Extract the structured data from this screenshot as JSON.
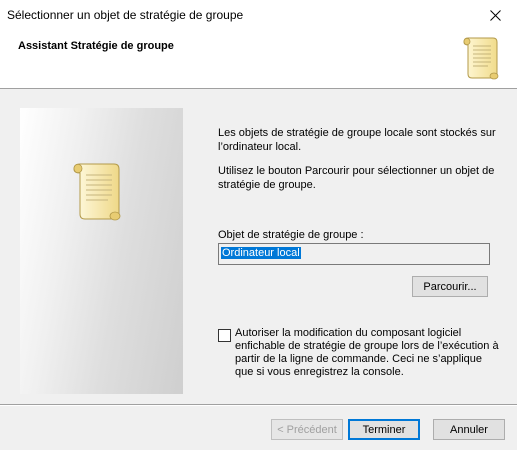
{
  "window": {
    "title": "Sélectionner un objet de stratégie de groupe"
  },
  "header": {
    "title": "Assistant Stratégie de groupe",
    "icon": "scroll-icon"
  },
  "side_panel": {
    "icon": "scroll-icon"
  },
  "description": {
    "line1": "Les objets de stratégie de groupe locale sont stockés sur l’ordinateur local.",
    "line2": "Utilisez le bouton Parcourir pour sélectionner un objet de stratégie de groupe."
  },
  "gpo_field": {
    "label": "Objet de stratégie de groupe :",
    "value": "Ordinateur local"
  },
  "buttons": {
    "browse": "Parcourir...",
    "previous": "< Précédent",
    "finish": "Terminer",
    "cancel": "Annuler"
  },
  "option": {
    "checked": false,
    "label": "Autoriser la modification du composant logiciel enfichable de stratégie de groupe lors de l’exécution à partir de la ligne de commande. Ceci ne s’applique que si vous enregistrez la console."
  },
  "colors": {
    "selection": "#0078d7",
    "window_bg": "#f0f0f0",
    "header_bg": "#ffffff"
  }
}
